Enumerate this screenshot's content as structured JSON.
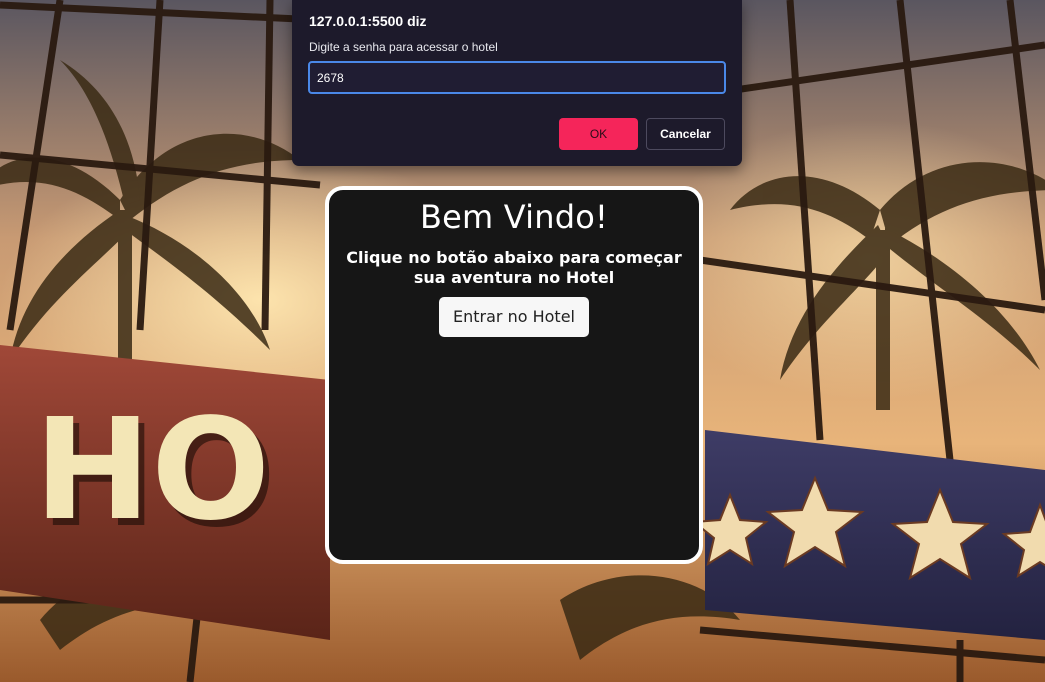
{
  "dialog": {
    "origin": "127.0.0.1:5500 diz",
    "message": "Digite a senha para acessar o hotel",
    "input_value": "2678",
    "ok_label": "OK",
    "cancel_label": "Cancelar",
    "accent_color": "#f5255a",
    "background_color": "#1d1a2b"
  },
  "card": {
    "title": "Bem Vindo!",
    "subtitle": "Clique no botão abaixo para começar sua aventura no Hotel",
    "button_label": "Entrar no Hotel",
    "background_color": "#161616"
  },
  "background": {
    "sign_text": "HO",
    "star_icon": "star-icon"
  }
}
